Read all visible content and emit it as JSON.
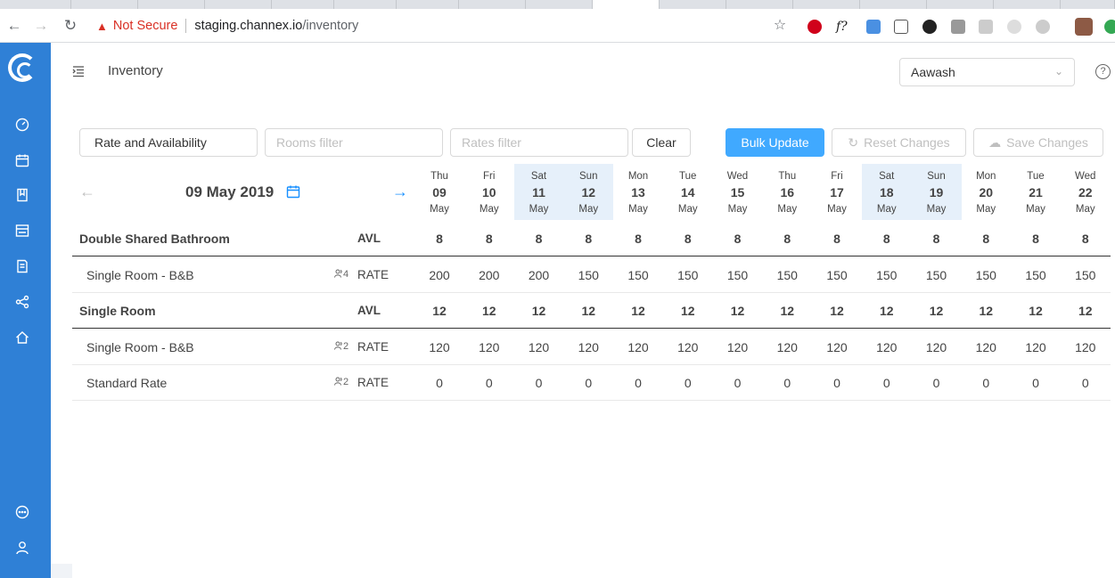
{
  "browser": {
    "not_secure": "Not Secure",
    "url_host": "staging.channex.io",
    "url_path": "/inventory"
  },
  "header": {
    "title": "Inventory",
    "account": "Aawash"
  },
  "filters": {
    "mode": "Rate and Availability",
    "rooms_placeholder": "Rooms filter",
    "rates_placeholder": "Rates filter",
    "clear": "Clear",
    "bulk_update": "Bulk Update",
    "reset_changes": "Reset Changes",
    "save_changes": "Save Changes"
  },
  "date_nav": {
    "current": "09 May 2019"
  },
  "days": [
    {
      "dow": "Thu",
      "day": "09",
      "mon": "May",
      "weekend": false
    },
    {
      "dow": "Fri",
      "day": "10",
      "mon": "May",
      "weekend": false
    },
    {
      "dow": "Sat",
      "day": "11",
      "mon": "May",
      "weekend": true
    },
    {
      "dow": "Sun",
      "day": "12",
      "mon": "May",
      "weekend": true
    },
    {
      "dow": "Mon",
      "day": "13",
      "mon": "May",
      "weekend": false
    },
    {
      "dow": "Tue",
      "day": "14",
      "mon": "May",
      "weekend": false
    },
    {
      "dow": "Wed",
      "day": "15",
      "mon": "May",
      "weekend": false
    },
    {
      "dow": "Thu",
      "day": "16",
      "mon": "May",
      "weekend": false
    },
    {
      "dow": "Fri",
      "day": "17",
      "mon": "May",
      "weekend": false
    },
    {
      "dow": "Sat",
      "day": "18",
      "mon": "May",
      "weekend": true
    },
    {
      "dow": "Sun",
      "day": "19",
      "mon": "May",
      "weekend": true
    },
    {
      "dow": "Mon",
      "day": "20",
      "mon": "May",
      "weekend": false
    },
    {
      "dow": "Tue",
      "day": "21",
      "mon": "May",
      "weekend": false
    },
    {
      "dow": "Wed",
      "day": "22",
      "mon": "May",
      "weekend": false
    }
  ],
  "rows": [
    {
      "type": "group",
      "label": "Double Shared Bathroom",
      "kind": "AVL",
      "occupancy": "",
      "values": [
        "8",
        "8",
        "8",
        "8",
        "8",
        "8",
        "8",
        "8",
        "8",
        "8",
        "8",
        "8",
        "8",
        "8"
      ]
    },
    {
      "type": "rate",
      "label": "Single Room - B&B",
      "kind": "RATE",
      "occupancy": "4",
      "values": [
        "200",
        "200",
        "200",
        "150",
        "150",
        "150",
        "150",
        "150",
        "150",
        "150",
        "150",
        "150",
        "150",
        "150"
      ]
    },
    {
      "type": "group",
      "label": "Single Room",
      "kind": "AVL",
      "occupancy": "",
      "values": [
        "12",
        "12",
        "12",
        "12",
        "12",
        "12",
        "12",
        "12",
        "12",
        "12",
        "12",
        "12",
        "12",
        "12"
      ]
    },
    {
      "type": "rate",
      "label": "Single Room - B&B",
      "kind": "RATE",
      "occupancy": "2",
      "values": [
        "120",
        "120",
        "120",
        "120",
        "120",
        "120",
        "120",
        "120",
        "120",
        "120",
        "120",
        "120",
        "120",
        "120"
      ]
    },
    {
      "type": "rate",
      "label": "Standard Rate",
      "kind": "RATE",
      "occupancy": "2",
      "values": [
        "0",
        "0",
        "0",
        "0",
        "0",
        "0",
        "0",
        "0",
        "0",
        "0",
        "0",
        "0",
        "0",
        "0"
      ]
    }
  ]
}
